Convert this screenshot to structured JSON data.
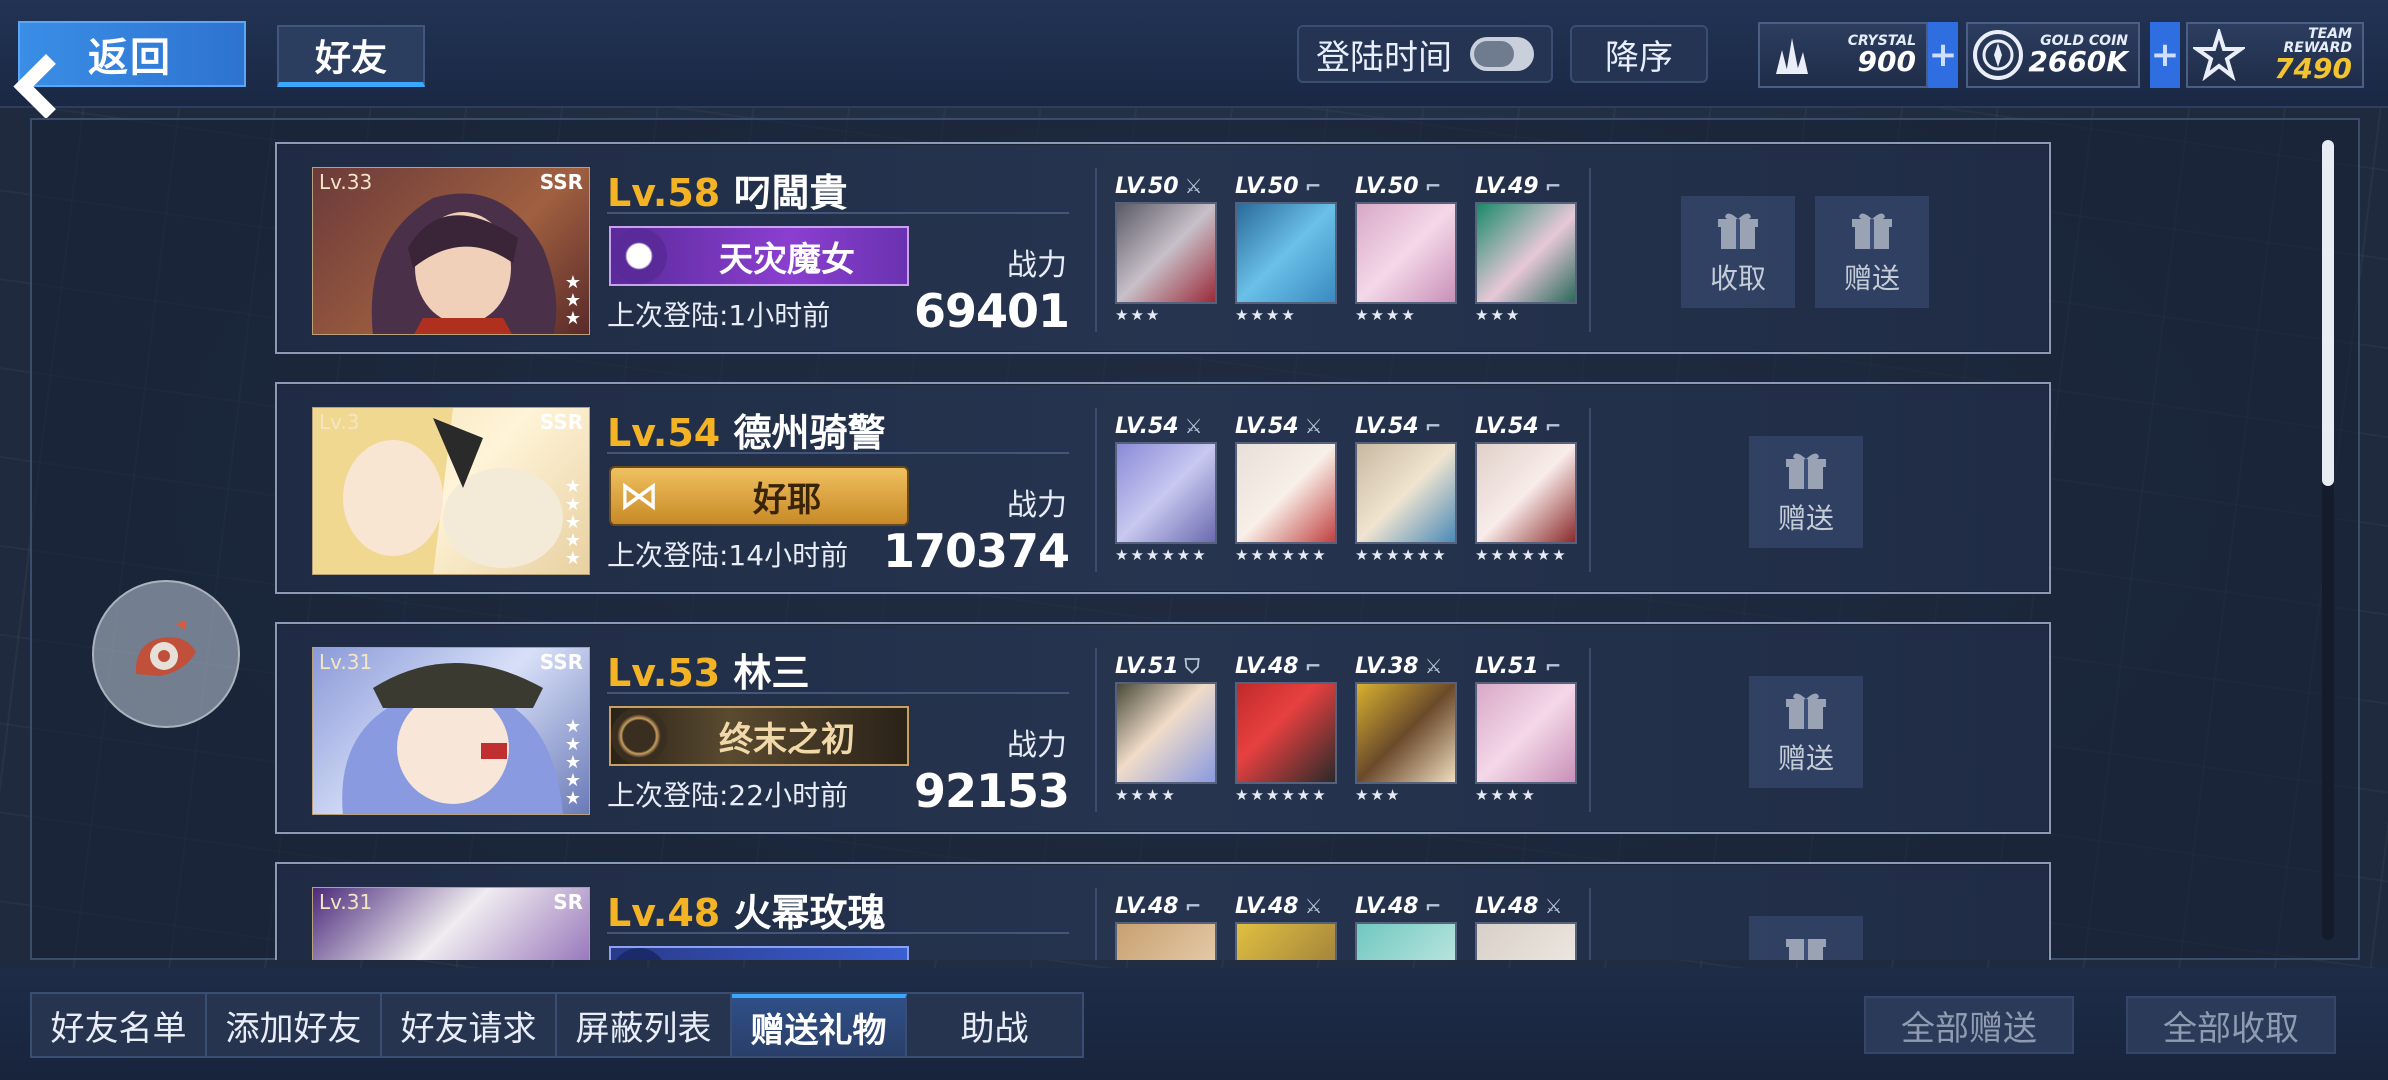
{
  "topbar": {
    "back_label": "返回",
    "tab_label": "好友",
    "login_sort_label": "登陆时间",
    "order_label": "降序",
    "resources": [
      {
        "label": "CRYSTAL",
        "value": "900",
        "icon": "crystal-icon"
      },
      {
        "label": "GOLD COIN",
        "value": "2660K",
        "icon": "gold-coin-icon"
      },
      {
        "label": "TEAM REWARD",
        "value": "7490",
        "icon": "team-reward-icon",
        "color": "#f4c430"
      }
    ]
  },
  "friends": [
    {
      "avatar_level": "Lv.33",
      "avatar_rarity": "SSR",
      "avatar_stars": "★\n★\n★",
      "level": "Lv.58",
      "name": "叼闆貴",
      "title": "天灾魔女",
      "title_color": "#8b3fd0",
      "last_login": "上次登陆:1小时前",
      "power_label": "战力",
      "power": "69401",
      "units": [
        {
          "level": "LV.50",
          "type_icon": "swords-icon",
          "stars": "★★★"
        },
        {
          "level": "LV.50",
          "type_icon": "rifle-icon",
          "stars": "★★★★"
        },
        {
          "level": "LV.50",
          "type_icon": "rifle-icon",
          "stars": "★★★★"
        },
        {
          "level": "LV.49",
          "type_icon": "rifle-icon",
          "stars": "★★★"
        }
      ],
      "buttons": [
        "收取",
        "赠送"
      ]
    },
    {
      "avatar_level": "Lv.3",
      "avatar_rarity": "SSR",
      "avatar_stars": "★\n★\n★\n★\n★",
      "level": "Lv.54",
      "name": "德州骑警",
      "title": "好耶",
      "title_color": "#d7a038",
      "last_login": "上次登陆:14小时前",
      "power_label": "战力",
      "power": "170374",
      "units": [
        {
          "level": "LV.54",
          "type_icon": "swords-icon",
          "stars": "★★★★★★"
        },
        {
          "level": "LV.54",
          "type_icon": "swords-icon",
          "stars": "★★★★★★"
        },
        {
          "level": "LV.54",
          "type_icon": "rifle-icon",
          "stars": "★★★★★★"
        },
        {
          "level": "LV.54",
          "type_icon": "rifle-icon",
          "stars": "★★★★★★"
        }
      ],
      "buttons": [
        "赠送"
      ]
    },
    {
      "avatar_level": "Lv.31",
      "avatar_rarity": "SSR",
      "avatar_stars": "★\n★\n★\n★\n★",
      "level": "Lv.53",
      "name": "林三",
      "title": "终末之初",
      "title_color": "#4a3a28",
      "last_login": "上次登陆:22小时前",
      "power_label": "战力",
      "power": "92153",
      "units": [
        {
          "level": "LV.51",
          "type_icon": "shield-icon",
          "stars": "★★★★"
        },
        {
          "level": "LV.48",
          "type_icon": "rifle-icon",
          "stars": "★★★★★★"
        },
        {
          "level": "LV.38",
          "type_icon": "swords-icon",
          "stars": "★★★"
        },
        {
          "level": "LV.51",
          "type_icon": "rifle-icon",
          "stars": "★★★★"
        }
      ],
      "buttons": [
        "赠送"
      ]
    },
    {
      "avatar_level": "Lv.31",
      "avatar_rarity": "SR",
      "avatar_stars": "",
      "level": "Lv.48",
      "name": "火幂玫瑰",
      "title": "",
      "title_color": "#3a5fd0",
      "last_login": "",
      "power_label": "",
      "power": "",
      "units": [
        {
          "level": "LV.48",
          "type_icon": "rifle-icon",
          "stars": ""
        },
        {
          "level": "LV.48",
          "type_icon": "swords-icon",
          "stars": ""
        },
        {
          "level": "LV.48",
          "type_icon": "rifle-icon",
          "stars": ""
        },
        {
          "level": "LV.48",
          "type_icon": "swords-icon",
          "stars": ""
        }
      ],
      "buttons": [
        "赠送"
      ]
    }
  ],
  "bottom_tabs": [
    "好友名单",
    "添加好友",
    "好友请求",
    "屏蔽列表",
    "赠送礼物",
    "助战"
  ],
  "active_tab": "赠送礼物",
  "send_all_label": "全部赠送",
  "collect_all_label": "全部收取"
}
